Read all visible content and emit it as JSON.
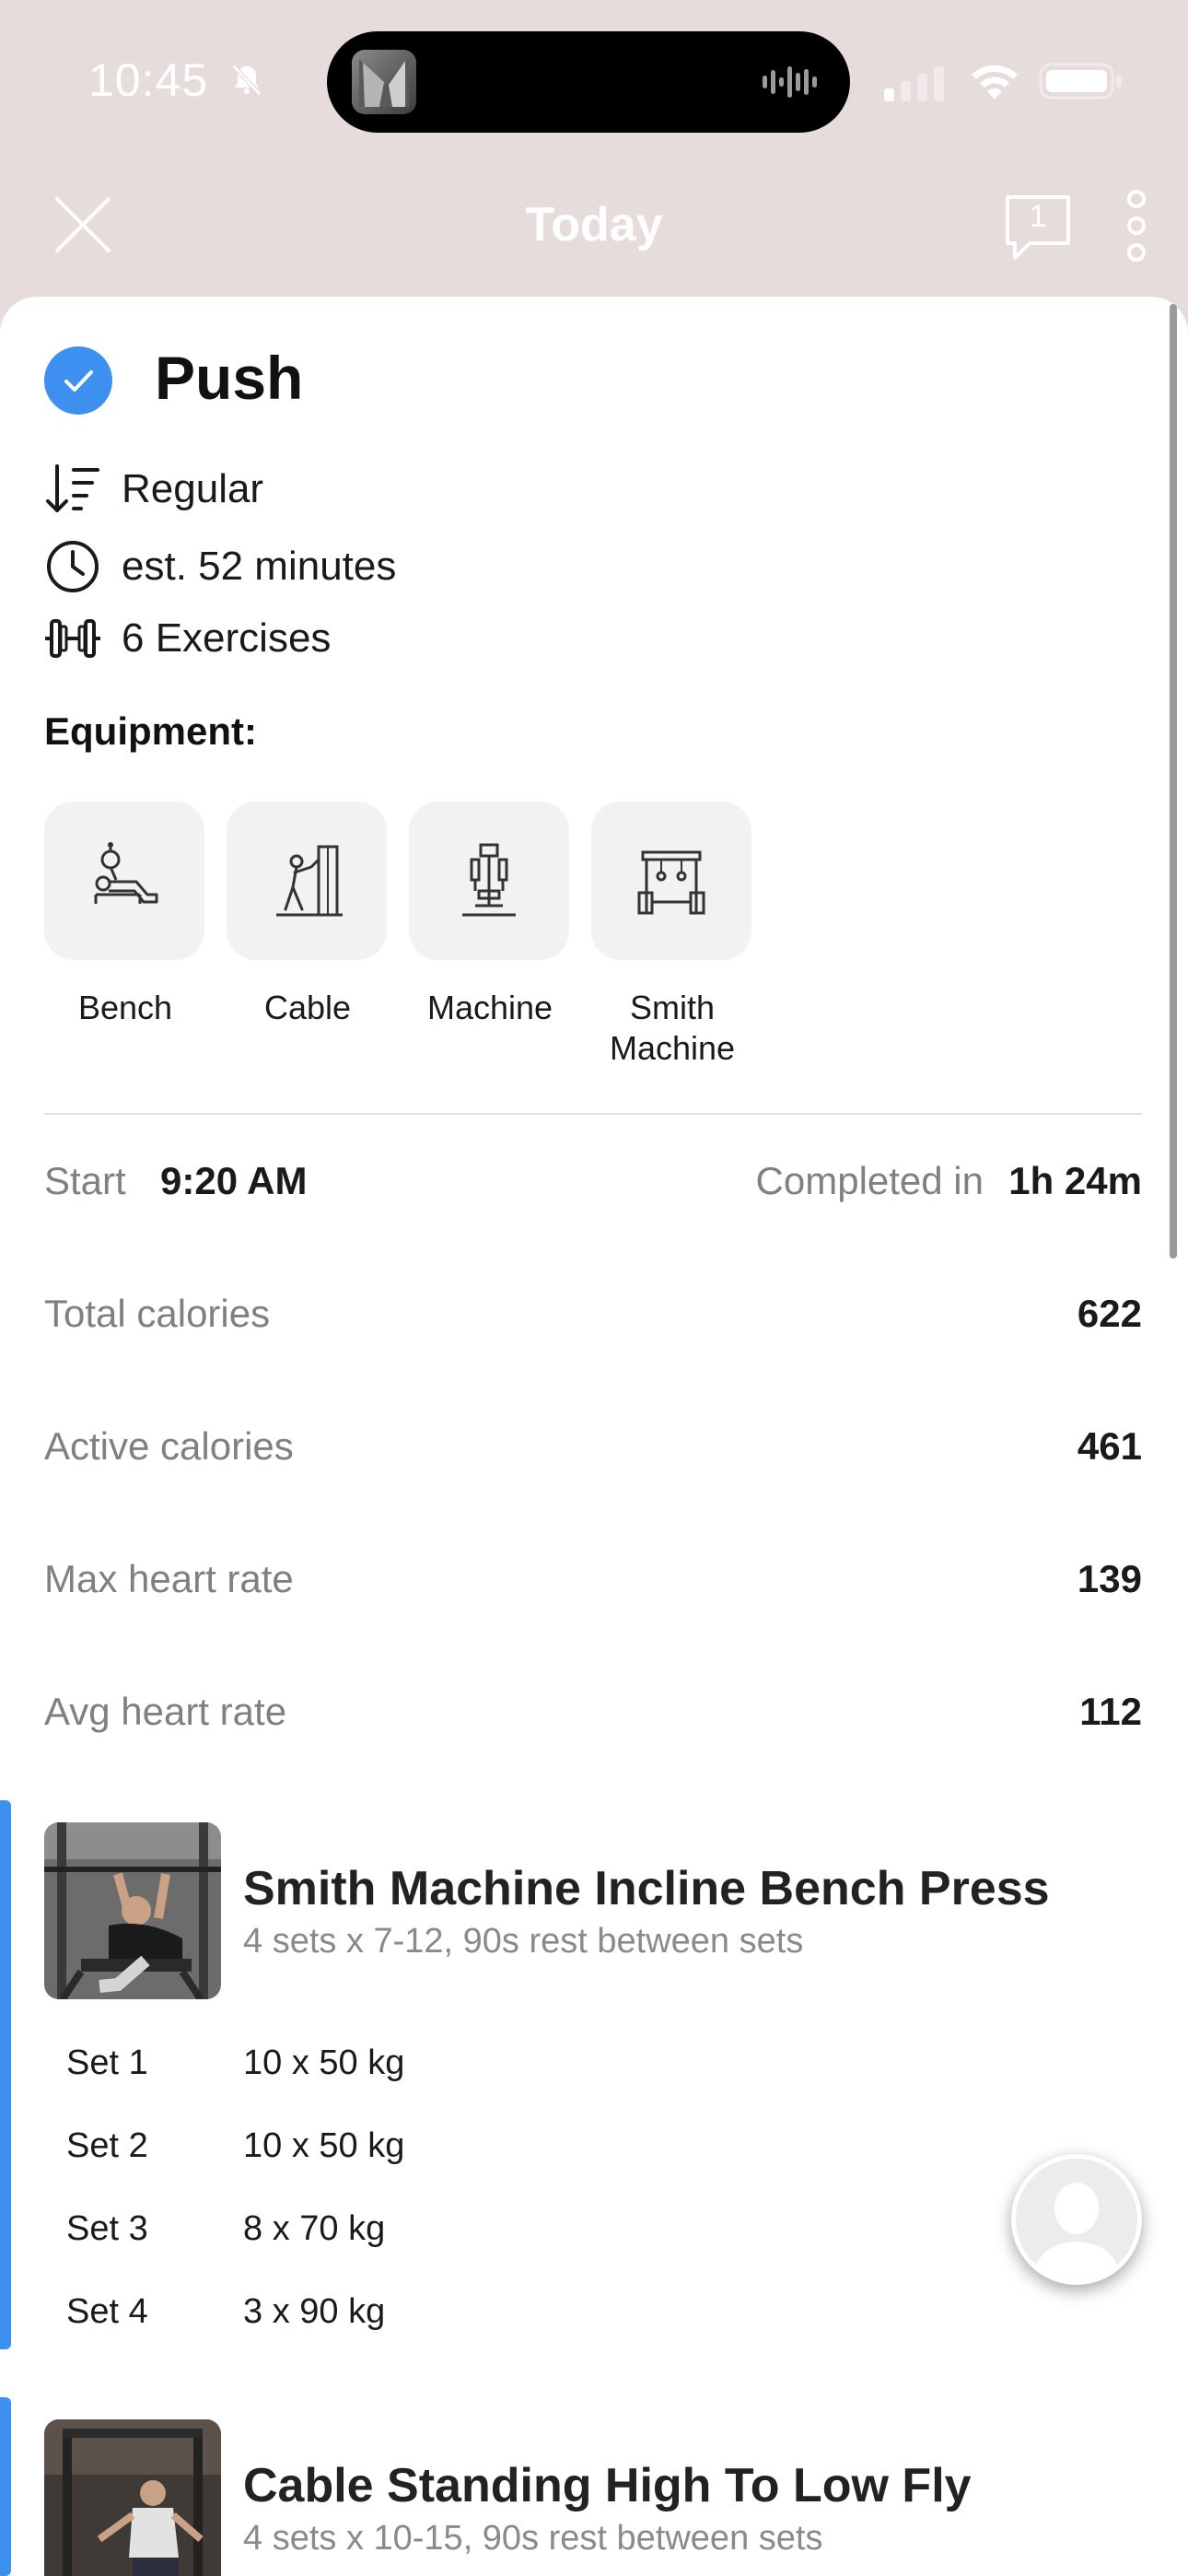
{
  "status_bar": {
    "time": "10:45"
  },
  "nav": {
    "title": "Today",
    "chat_count": "1"
  },
  "workout": {
    "title": "Push",
    "meta": [
      {
        "icon": "sort-descending-icon",
        "text": "Regular"
      },
      {
        "icon": "clock-icon",
        "text": "est. 52 minutes"
      },
      {
        "icon": "dumbbell-icon",
        "text": "6 Exercises"
      }
    ]
  },
  "equipment": {
    "label": "Equipment:",
    "items": [
      {
        "icon": "bench-icon",
        "name": "Bench"
      },
      {
        "icon": "cable-icon",
        "name": "Cable"
      },
      {
        "icon": "machine-icon",
        "name": "Machine"
      },
      {
        "icon": "smith-machine-icon",
        "name": "Smith Machine"
      }
    ]
  },
  "summary": {
    "start_label": "Start",
    "start_value": "9:20 AM",
    "completed_label": "Completed in",
    "completed_value": "1h 24m",
    "stats": [
      {
        "label": "Total calories",
        "value": "622"
      },
      {
        "label": "Active calories",
        "value": "461"
      },
      {
        "label": "Max heart rate",
        "value": "139"
      },
      {
        "label": "Avg heart rate",
        "value": "112"
      }
    ]
  },
  "exercises": [
    {
      "name": "Smith Machine Incline Bench Press",
      "detail": "4 sets x 7-12, 90s rest between sets",
      "sets": [
        {
          "label": "Set 1",
          "value": "10 x 50 kg"
        },
        {
          "label": "Set 2",
          "value": "10 x 50 kg"
        },
        {
          "label": "Set 3",
          "value": "8 x 70 kg"
        },
        {
          "label": "Set 4",
          "value": "3 x 90 kg"
        }
      ]
    },
    {
      "name": "Cable Standing High To Low Fly",
      "detail": "4 sets x 10-15, 90s rest between sets",
      "sets": []
    }
  ],
  "colors": {
    "accent": "#3d8ff0",
    "header_bg": "#e7dcdc",
    "muted_text": "#808080"
  }
}
